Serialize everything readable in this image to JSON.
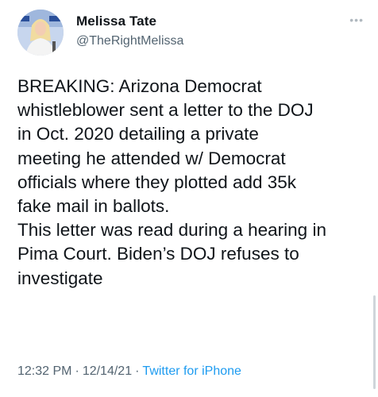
{
  "author": {
    "name": "Melissa Tate",
    "handle": "@TheRightMelissa"
  },
  "more_icon": "more-dots-icon",
  "tweet": {
    "text": "BREAKING: Arizona Democrat\nwhistleblower sent a letter to the DOJ\nin Oct. 2020 detailing a private\nmeeting he attended w/ Democrat\nofficials where they plotted add 35k\nfake mail in ballots.\nThis letter was read during a hearing in\nPima Court. Biden’s DOJ refuses to\ninvestigate"
  },
  "meta": {
    "time": "12:32 PM",
    "date": "12/14/21",
    "source": "Twitter for iPhone",
    "separator": "·"
  },
  "colors": {
    "text": "#0f1419",
    "secondary": "#536471",
    "link": "#1d9bf0"
  }
}
